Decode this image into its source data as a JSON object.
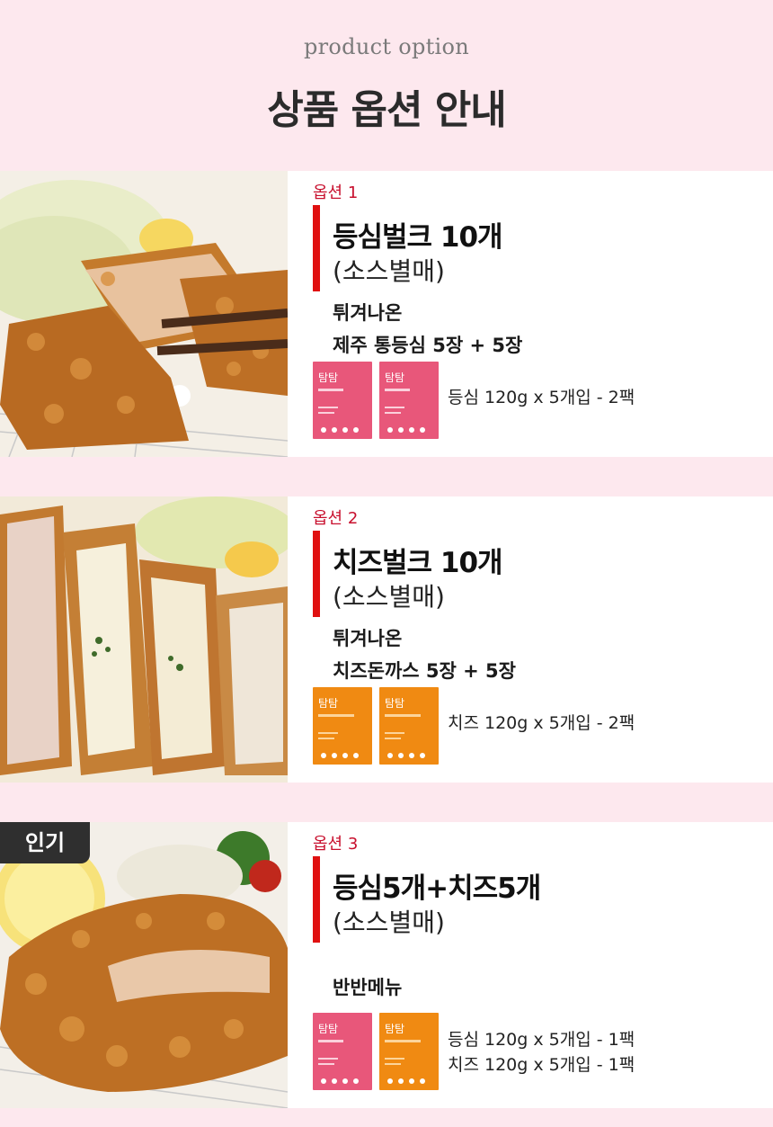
{
  "header": {
    "subtitle": "product option",
    "title": "상품 옵션 안내"
  },
  "options": [
    {
      "label": "옵션 1",
      "name": "등심벌크 10개",
      "sauce": "(소스별매)",
      "desc_lines": [
        "튀겨나온",
        "제주 통등심 5장 + 5장"
      ],
      "packs": [
        "pink",
        "pink"
      ],
      "pack_lines": [
        "등심 120g x 5개입 - 2팩"
      ]
    },
    {
      "label": "옵션 2",
      "name": "치즈벌크 10개",
      "sauce": "(소스별매)",
      "desc_lines": [
        "튀겨나온",
        "치즈돈까스 5장 + 5장"
      ],
      "packs": [
        "orange",
        "orange"
      ],
      "pack_lines": [
        "치즈 120g x 5개입 - 2팩"
      ]
    },
    {
      "label": "옵션 3",
      "badge": "인기",
      "name": "등심5개+치즈5개",
      "sauce": "(소스별매)",
      "desc_lines": [
        "반반메뉴"
      ],
      "packs": [
        "pink",
        "orange"
      ],
      "pack_lines": [
        "등심 120g x 5개입 - 1팩",
        "치즈 120g x 5개입 - 1팩"
      ]
    }
  ],
  "pack_brand": "탐탐",
  "colors": {
    "background": "#fde8ee",
    "accent_red": "#e01010",
    "option_label": "#c8102e",
    "pack_pink": "#e8577a",
    "pack_orange": "#f08a12"
  }
}
